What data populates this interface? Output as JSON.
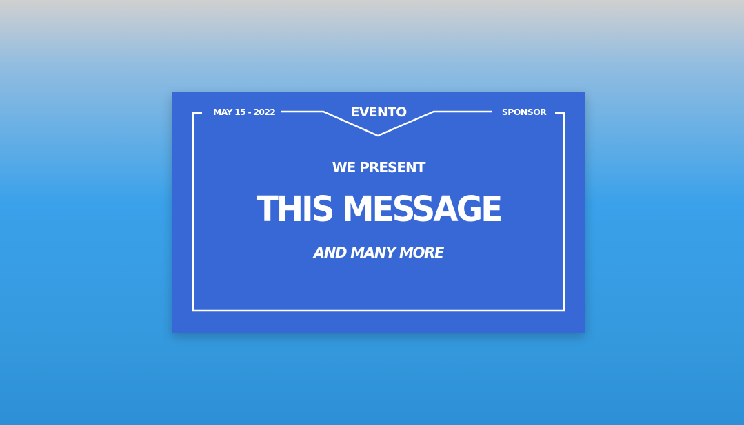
{
  "banner": {
    "date": "MAY 15 - 2022",
    "event_name": "EVENTO",
    "sponsor": "SPONSOR",
    "intro": "WE PRESENT",
    "headline": "THIS MESSAGE",
    "subtitle": "AND MANY MORE"
  },
  "colors": {
    "card_background": "#3868d6",
    "text": "#ffffff"
  }
}
